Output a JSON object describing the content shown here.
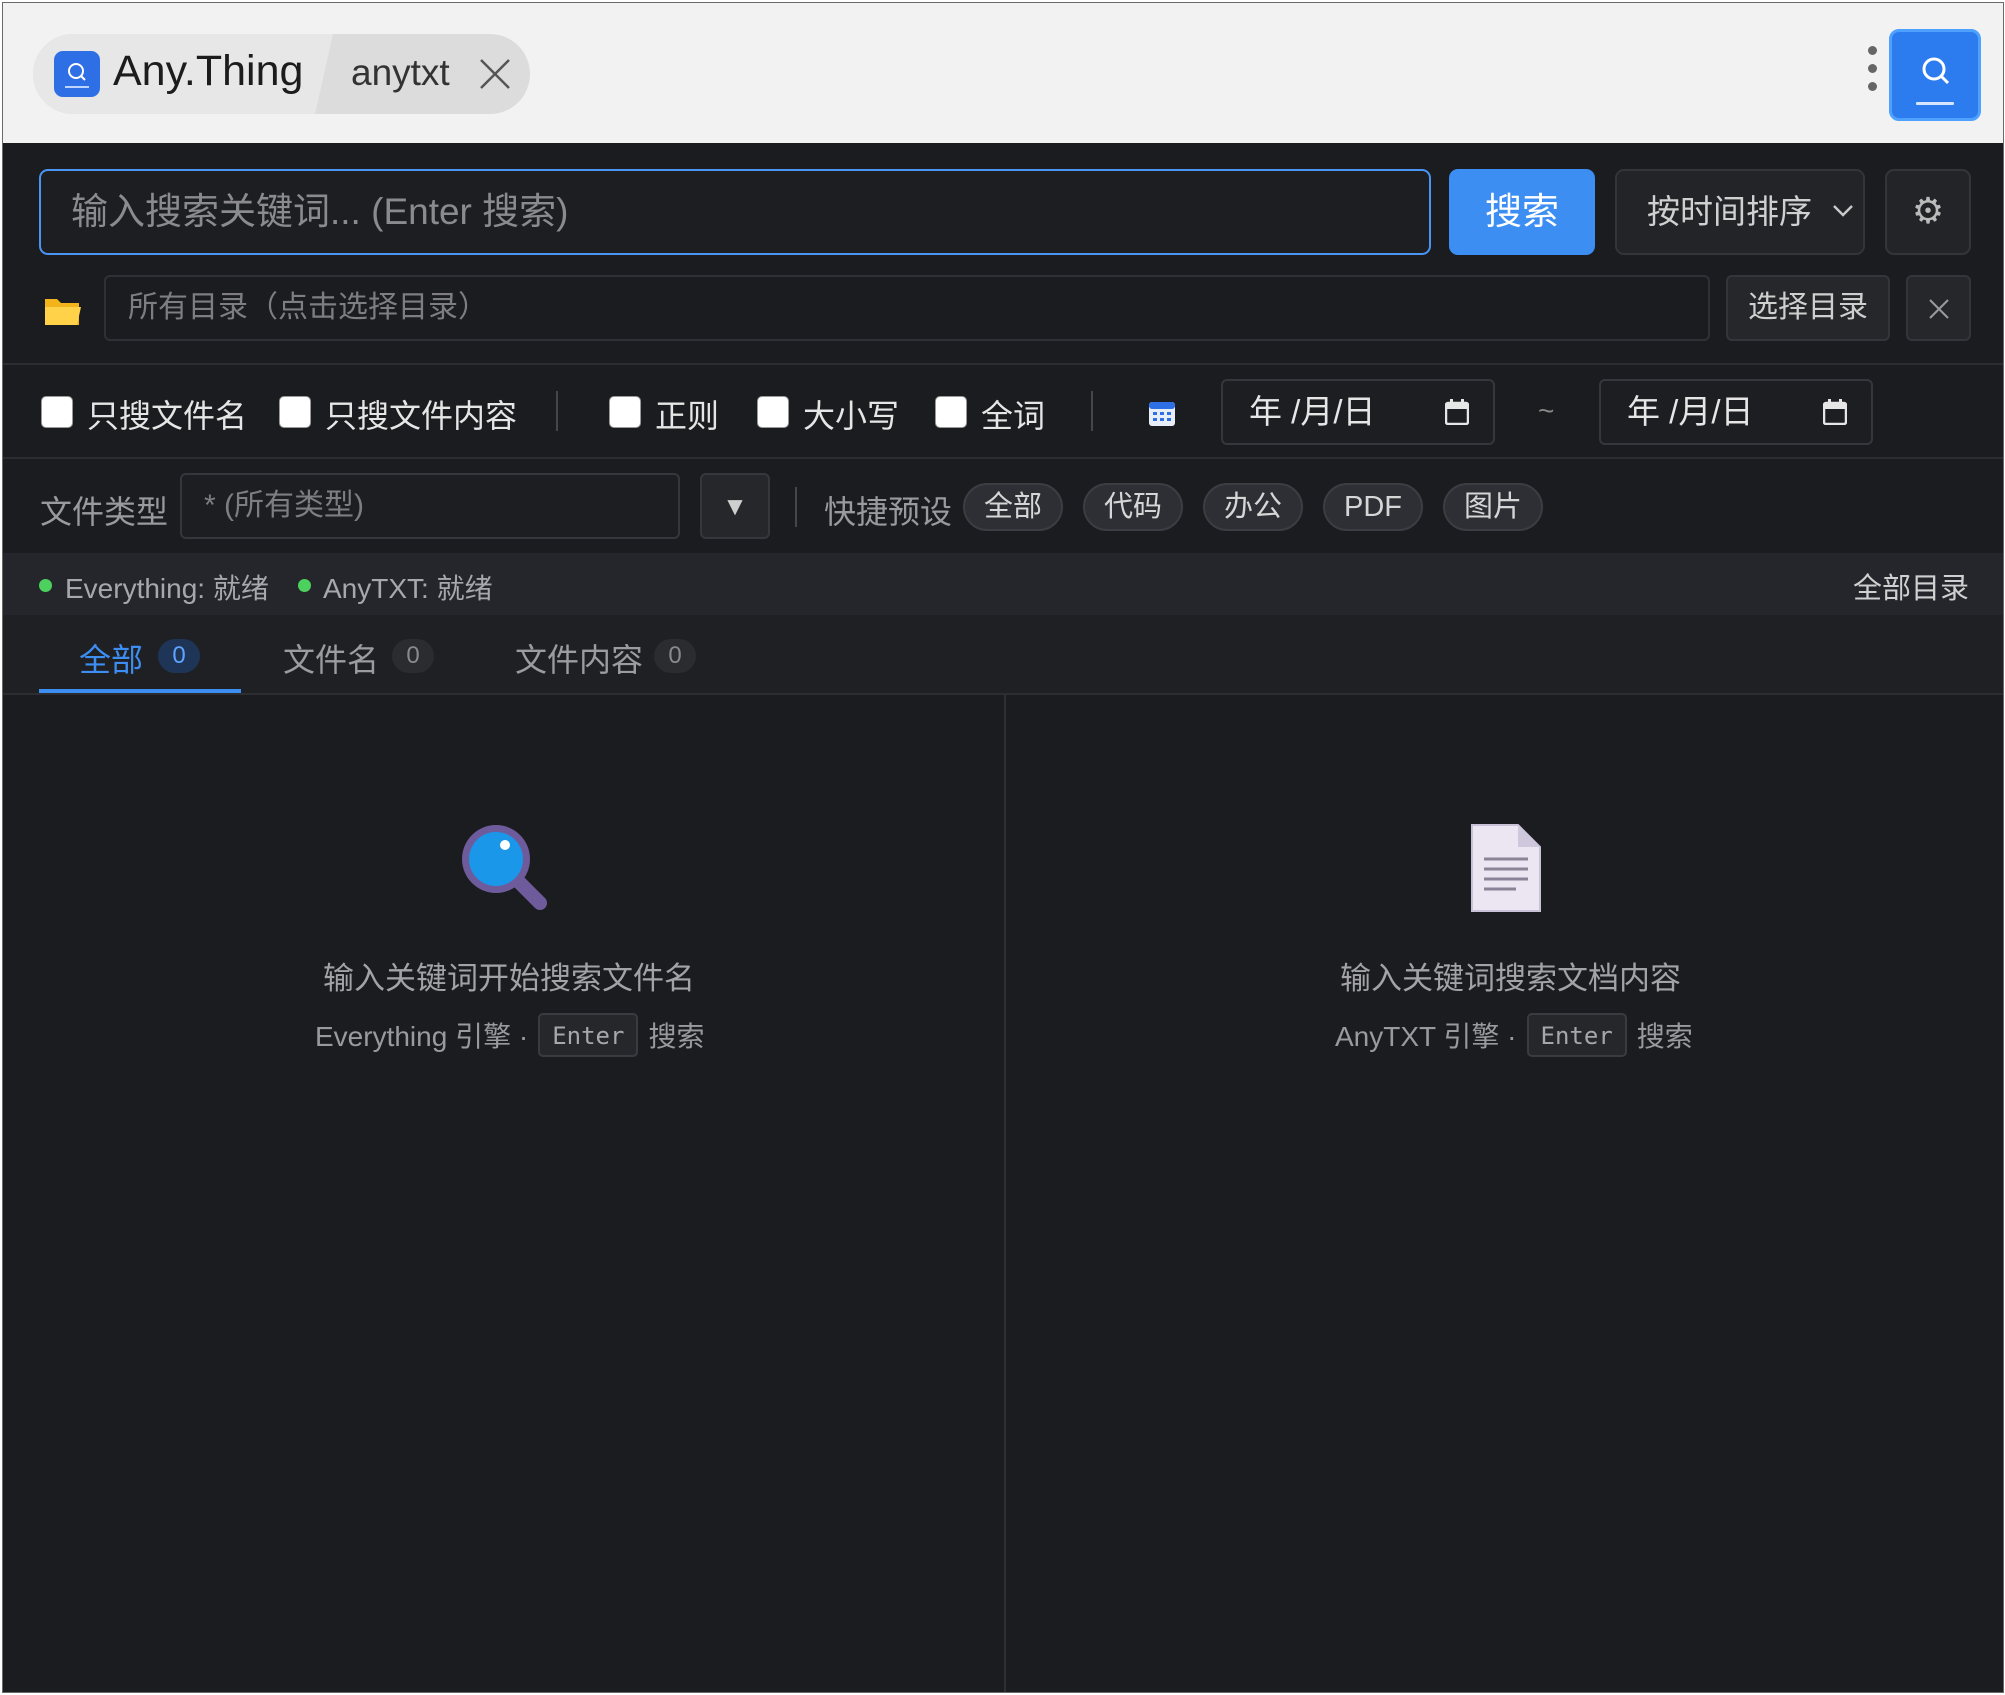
{
  "tabs": {
    "app_title": "Any.Thing",
    "second_tab": "anytxt"
  },
  "search": {
    "placeholder": "输入搜索关键词... (Enter 搜索)",
    "button": "搜索",
    "sort": "按时间排序"
  },
  "directory": {
    "placeholder": "所有目录（点击选择目录）",
    "choose_button": "选择目录"
  },
  "options": {
    "filename_only": "只搜文件名",
    "content_only": "只搜文件内容",
    "regex": "正则",
    "case": "大小写",
    "whole_word": "全词",
    "date_from": "年 /月/日",
    "date_separator": "~",
    "date_to": "年 /月/日"
  },
  "filetype": {
    "label": "文件类型",
    "placeholder": "* (所有类型)",
    "dropdown_glyph": "▼",
    "preset_label": "快捷预设",
    "presets": [
      "全部",
      "代码",
      "办公",
      "PDF",
      "图片"
    ]
  },
  "status": {
    "everything": "Everything: 就绪",
    "anytxt": "AnyTXT: 就绪",
    "scope": "全部目录",
    "ready_color": "#4cd05e"
  },
  "result_tabs": [
    {
      "label": "全部",
      "count": "0",
      "active": true
    },
    {
      "label": "文件名",
      "count": "0",
      "active": false
    },
    {
      "label": "文件内容",
      "count": "0",
      "active": false
    }
  ],
  "left_panel": {
    "icon": "magnifier-icon",
    "title": "输入关键词开始搜索文件名",
    "engine": "Everything 引擎 ·",
    "key": "Enter",
    "action": "搜索"
  },
  "right_panel": {
    "icon": "document-icon",
    "title": "输入关键词搜索文档内容",
    "engine": "AnyTXT 引擎 ·",
    "key": "Enter",
    "action": "搜索"
  },
  "colors": {
    "accent": "#3d8ef2",
    "background": "#1b1c1f"
  }
}
